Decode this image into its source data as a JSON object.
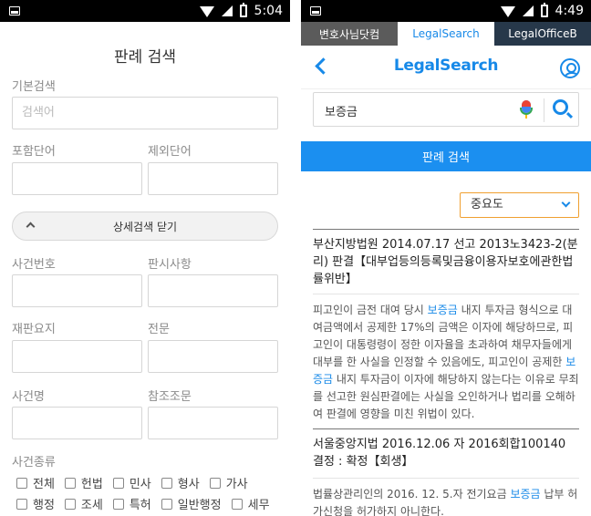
{
  "left_screen": {
    "status": {
      "time": "5:04"
    },
    "title": "판례 검색",
    "basic_search": {
      "label": "기본검색",
      "placeholder": "검색어"
    },
    "include_words": {
      "label": "포함단어"
    },
    "exclude_words": {
      "label": "제외단어"
    },
    "detail_toggle": {
      "label": "상세검색 닫기"
    },
    "case_number": {
      "label": "사건번호"
    },
    "ruling_matters": {
      "label": "판시사항"
    },
    "ruling_summary": {
      "label": "재판요지"
    },
    "full_text": {
      "label": "전문"
    },
    "case_name": {
      "label": "사건명"
    },
    "ref_articles": {
      "label": "참조조문"
    },
    "case_types": {
      "label": "사건종류",
      "row1": [
        "전체",
        "헌법",
        "민사",
        "형사",
        "가사"
      ],
      "row2": [
        "행정",
        "조세",
        "특허",
        "일반행정",
        "세무"
      ]
    }
  },
  "right_screen": {
    "status": {
      "time": "4:49"
    },
    "tabs": [
      "변호사님닷컴",
      "LegalSearch",
      "LegalOfficeB"
    ],
    "active_tab": 1,
    "logo": "LegalSearch",
    "search": {
      "value": "보증금"
    },
    "search_button": "판례 검색",
    "sort": {
      "selected": "중요도"
    },
    "results": [
      {
        "title": "부산지방법원 2014.07.17 선고 2013노3423-2(분리) 판결【대부업등의등록및금융이용자보호에관한법률위반】",
        "body_parts": [
          {
            "text": "피고인이 금전 대여 당시 ",
            "hl": false
          },
          {
            "text": "보증금",
            "hl": true
          },
          {
            "text": " 내지 투자금 형식으로 대여금액에서 공제한 17%의 금액은 이자에 해당하므로, 피고인이 대통령령이 정한 이자율을 초과하여 채무자들에게 대부를 한 사실을 인정할 수 있음에도, 피고인이 공제한 ",
            "hl": false
          },
          {
            "text": "보증금",
            "hl": true
          },
          {
            "text": " 내지 투자금이 이자에 해당하지 않는다는 이유로 무죄를 선고한 원심판결에는 사실을 오인하거나 법리를 오해하여 판결에 영향을 미친 위법이 있다.",
            "hl": false
          }
        ]
      },
      {
        "title": "서울중앙지법 2016.12.06 자 2016회합100140 결정 : 확정【회생】",
        "body_parts": [
          {
            "text": "법률상관리인의 2016. 12. 5.자 전기요금 ",
            "hl": false
          },
          {
            "text": "보증금",
            "hl": true
          },
          {
            "text": " 납부 허가신청을 허가하지 아니한다.",
            "hl": false
          }
        ]
      }
    ]
  },
  "colors": {
    "accent": "#1789e8",
    "button": "#1b8ff0",
    "sort_border": "#f0a030"
  }
}
